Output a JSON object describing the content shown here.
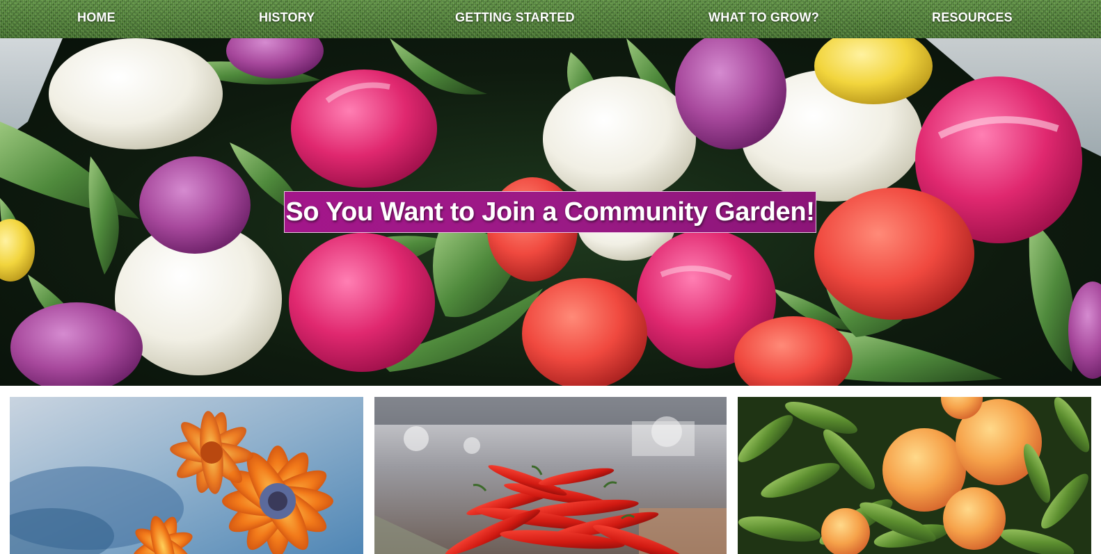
{
  "nav": {
    "items": [
      {
        "label": "HOME"
      },
      {
        "label": "HISTORY"
      },
      {
        "label": "GETTING STARTED"
      },
      {
        "label": "WHAT TO GROW?"
      },
      {
        "label": "RESOURCES"
      }
    ]
  },
  "hero": {
    "title": "So You Want to Join a Community Garden!"
  },
  "colors": {
    "nav_grass": "#4f7d3a",
    "title_magenta": "#9b1a86",
    "tulip_pink": "#e0286f",
    "tulip_purple": "#a7489c",
    "tulip_white": "#f1efe4",
    "tulip_red": "#f0493f",
    "tulip_yellow": "#f2d53d"
  },
  "cards": [
    {
      "image": "orange-gerbera-flowers"
    },
    {
      "image": "red-chili-peppers-market"
    },
    {
      "image": "peaches-on-tree"
    }
  ]
}
